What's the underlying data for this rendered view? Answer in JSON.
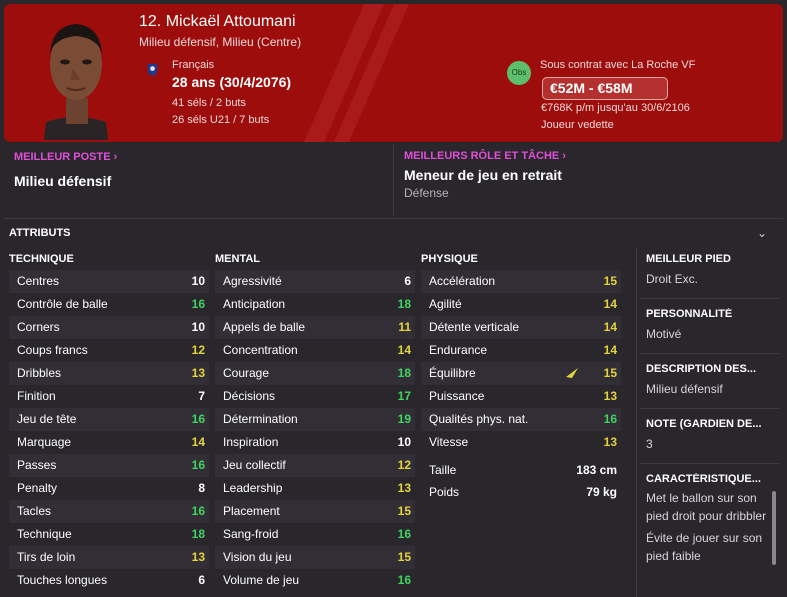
{
  "player": {
    "name": "12. Mickaël Attoumani",
    "positions": "Milieu défensif, Milieu (Centre)",
    "nationality": "Français",
    "age": "28 ans (30/4/2076)",
    "caps": "41 séls / 2 buts",
    "caps_u21": "26 séls U21 / 7 buts"
  },
  "contract": {
    "badge": "Obs",
    "club": "Sous contrat avec La Roche VF",
    "value": "€52M - €58M",
    "wage": "€768K p/m jusqu'au 30/6/2106",
    "status": "Joueur vedette"
  },
  "best_position": {
    "label": "MEILLEUR POSTE",
    "value": "Milieu défensif"
  },
  "best_role": {
    "label": "MEILLEURS RÔLE ET TÂCHE",
    "value": "Meneur de jeu en retrait",
    "duty": "Défense"
  },
  "attributes_title": "ATTRIBUTS",
  "colors": {
    "white": "#ffffff",
    "yellow": "#e4d43b",
    "green": "#3fd461",
    "header": "#9c0d0c",
    "accent": "#e04fd7"
  },
  "columns": {
    "technique": {
      "title": "TECHNIQUE",
      "rows": [
        {
          "label": "Centres",
          "value": "10"
        },
        {
          "label": "Contrôle de balle",
          "value": "16"
        },
        {
          "label": "Corners",
          "value": "10"
        },
        {
          "label": "Coups francs",
          "value": "12"
        },
        {
          "label": "Dribbles",
          "value": "13"
        },
        {
          "label": "Finition",
          "value": "7"
        },
        {
          "label": "Jeu de tête",
          "value": "16"
        },
        {
          "label": "Marquage",
          "value": "14"
        },
        {
          "label": "Passes",
          "value": "16"
        },
        {
          "label": "Penalty",
          "value": "8"
        },
        {
          "label": "Tacles",
          "value": "16"
        },
        {
          "label": "Technique",
          "value": "18"
        },
        {
          "label": "Tirs de loin",
          "value": "13"
        },
        {
          "label": "Touches longues",
          "value": "6"
        }
      ]
    },
    "mental": {
      "title": "MENTAL",
      "rows": [
        {
          "label": "Agressivité",
          "value": "6"
        },
        {
          "label": "Anticipation",
          "value": "18"
        },
        {
          "label": "Appels de balle",
          "value": "11"
        },
        {
          "label": "Concentration",
          "value": "14"
        },
        {
          "label": "Courage",
          "value": "18"
        },
        {
          "label": "Décisions",
          "value": "17"
        },
        {
          "label": "Détermination",
          "value": "19"
        },
        {
          "label": "Inspiration",
          "value": "10"
        },
        {
          "label": "Jeu collectif",
          "value": "12"
        },
        {
          "label": "Leadership",
          "value": "13"
        },
        {
          "label": "Placement",
          "value": "15"
        },
        {
          "label": "Sang-froid",
          "value": "16"
        },
        {
          "label": "Vision du jeu",
          "value": "15"
        },
        {
          "label": "Volume de jeu",
          "value": "16"
        }
      ]
    },
    "physique": {
      "title": "PHYSIQUE",
      "rows": [
        {
          "label": "Accélération",
          "value": "15"
        },
        {
          "label": "Agilité",
          "value": "14"
        },
        {
          "label": "Détente verticale",
          "value": "14"
        },
        {
          "label": "Endurance",
          "value": "14"
        },
        {
          "label": "Équilibre",
          "value": "15"
        },
        {
          "label": "Puissance",
          "value": "13"
        },
        {
          "label": "Qualités phys. nat.",
          "value": "16"
        },
        {
          "label": "Vitesse",
          "value": "13"
        }
      ],
      "height_label": "Taille",
      "height": "183 cm",
      "weight_label": "Poids",
      "weight": "79 kg"
    }
  },
  "side": {
    "foot_label": "MEILLEUR PIED",
    "foot": "Droit Exc.",
    "personality_label": "PERSONNALITÉ",
    "personality": "Motivé",
    "description_label": "DESCRIPTION DES...",
    "description": "Milieu défensif",
    "gk_label": "NOTE (GARDIEN DE...",
    "gk": "3",
    "traits_label": "CARACTÉRISTIQUE...",
    "trait1": "Met le ballon sur son pied droit pour dribbler",
    "trait2": "Évite de jouer sur son pied faible"
  }
}
